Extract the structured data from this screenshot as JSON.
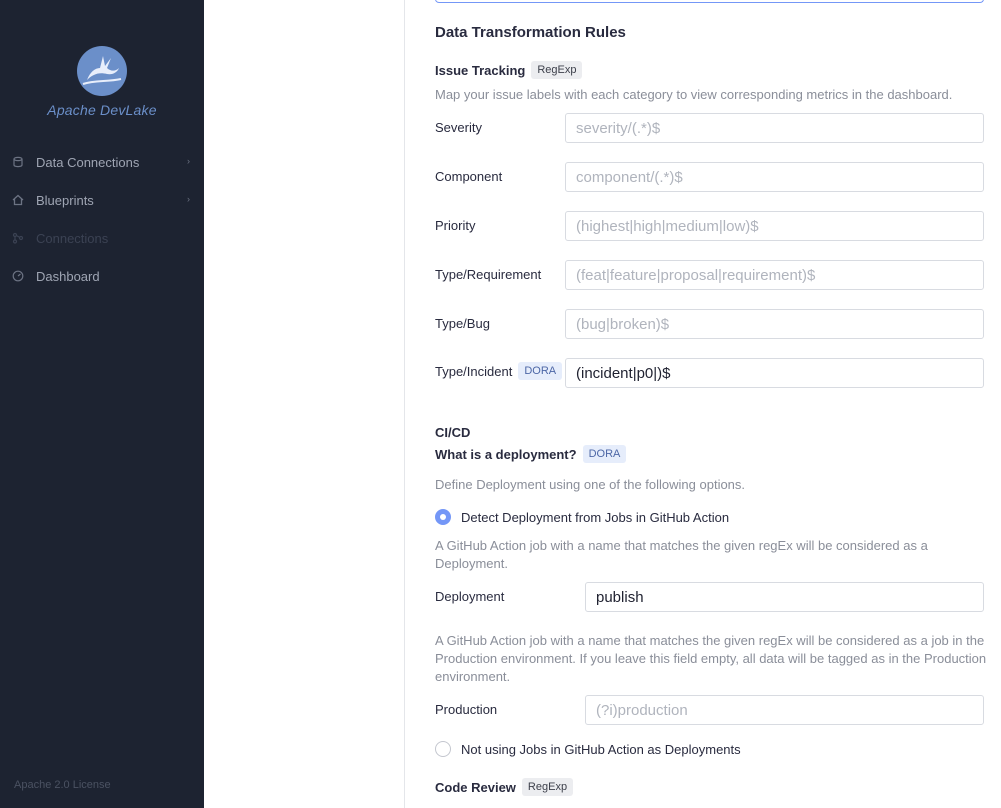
{
  "sidebar": {
    "brand": "Apache DevLake",
    "items": [
      {
        "label": "Data Connections",
        "icon": "database-icon",
        "chevron": "›"
      },
      {
        "label": "Blueprints",
        "icon": "home-icon",
        "chevron": "›"
      },
      {
        "label": "Connections",
        "icon": "git-icon"
      },
      {
        "label": "Dashboard",
        "icon": "gauge-icon"
      }
    ],
    "license": "Apache 2.0 License"
  },
  "section_title": "Data Transformation Rules",
  "issue_tracking": {
    "title": "Issue Tracking",
    "tag": "RegExp",
    "description": "Map your issue labels with each category to view corresponding metrics in the dashboard.",
    "fields": [
      {
        "label": "Severity",
        "placeholder": "severity/(.*)$",
        "value": ""
      },
      {
        "label": "Component",
        "placeholder": "component/(.*)$",
        "value": ""
      },
      {
        "label": "Priority",
        "placeholder": "(highest|high|medium|low)$",
        "value": ""
      },
      {
        "label": "Type/Requirement",
        "placeholder": "(feat|feature|proposal|requirement)$",
        "value": ""
      },
      {
        "label": "Type/Bug",
        "placeholder": "(bug|broken)$",
        "value": ""
      },
      {
        "label": "Type/Incident",
        "tag": "DORA",
        "placeholder": "",
        "value": "(incident|p0|)$"
      }
    ]
  },
  "cicd": {
    "title": "CI/CD",
    "question": "What is a deployment?",
    "question_tag": "DORA",
    "description": "Define Deployment using one of the following options.",
    "option1": "Detect Deployment from Jobs in GitHub Action",
    "deployment_help": "A GitHub Action job with a name that matches the given regEx will be considered as a Deployment.",
    "deployment_label": "Deployment",
    "deployment_value": "publish",
    "production_help": "A GitHub Action job with a name that matches the given regEx will be considered as a job in the Production environment. If you leave this field empty, all data will be tagged as in the Production environment.",
    "production_label": "Production",
    "production_placeholder": "(?i)production",
    "option2": "Not using Jobs in GitHub Action as Deployments"
  },
  "code_review": {
    "title": "Code Review",
    "tag": "RegExp"
  },
  "colors": {
    "sidebar_bg": "#1d2331",
    "accent": "#7497f7"
  }
}
